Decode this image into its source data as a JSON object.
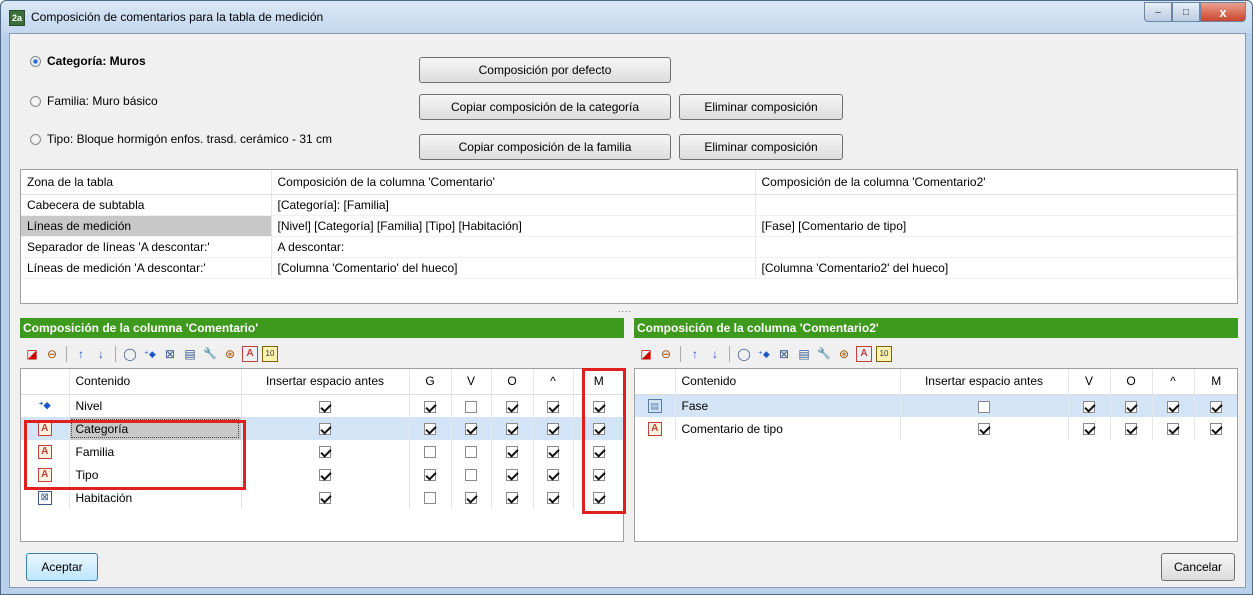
{
  "window": {
    "title": "Composición de comentarios para la tabla de medición",
    "app_icon": "2a",
    "buttons": {
      "minimize": "–",
      "maximize": "□",
      "close": "x"
    }
  },
  "options": {
    "categoria": "Categoría: Muros",
    "familia": "Familia: Muro básico",
    "tipo": "Tipo: Bloque hormigón enfos. trasd. cerámico - 31 cm"
  },
  "actions": {
    "default": "Composición por defecto",
    "copy_cat": "Copiar composición de la categoría",
    "del1": "Eliminar composición",
    "copy_fam": "Copiar composición de la familia",
    "del2": "Eliminar composición"
  },
  "zones": {
    "headers": [
      "Zona de la tabla",
      "Composición de la columna 'Comentario'",
      "Composición de la columna 'Comentario2'"
    ],
    "rows": [
      [
        "Cabecera de subtabla",
        "[Categoría]: [Familia]",
        ""
      ],
      [
        "Líneas de medición",
        "[Nivel] [Categoría] [Familia] [Tipo] [Habitación]",
        "[Fase] [Comentario de tipo]"
      ],
      [
        "Separador de líneas 'A descontar:'",
        "A descontar:",
        ""
      ],
      [
        "Líneas de medición 'A descontar:'",
        "[Columna 'Comentario' del hueco]",
        "[Columna 'Comentario2' del hueco]"
      ]
    ]
  },
  "splitter": "....",
  "left": {
    "title": "Composición de la columna 'Comentario'",
    "headers": [
      "Contenido",
      "Insertar espacio antes",
      "G",
      "V",
      "O",
      "^",
      "M"
    ],
    "rows": [
      {
        "name": "Nivel",
        "icon": "⁺◆"
      },
      {
        "name": "Categoría",
        "icon": "A"
      },
      {
        "name": "Familia",
        "icon": "A"
      },
      {
        "name": "Tipo",
        "icon": "A"
      },
      {
        "name": "Habitación",
        "icon": "⊠"
      }
    ]
  },
  "right": {
    "title": "Composición de la columna 'Comentario2'",
    "headers": [
      "Contenido",
      "Insertar espacio antes",
      "V",
      "O",
      "^",
      "M"
    ],
    "rows": [
      {
        "name": "Fase",
        "icon": "▤"
      },
      {
        "name": "Comentario de tipo",
        "icon": "A"
      }
    ]
  },
  "toolbar_icons": [
    "delete-icon",
    "edit-icon",
    "arrow-up-icon",
    "arrow-down-icon",
    "shape-icon",
    "level-icon",
    "room-icon",
    "phase-icon",
    "tool-icon",
    "parameter-icon",
    "text-icon",
    "number-icon"
  ],
  "toolbar_glyphs": [
    "◪",
    "⊖",
    "↑",
    "↓",
    "◯",
    "⁺◆",
    "⊠",
    "▤",
    "🔧",
    "⊛",
    "A",
    "10"
  ],
  "footer": {
    "ok": "Aceptar",
    "cancel": "Cancelar"
  }
}
